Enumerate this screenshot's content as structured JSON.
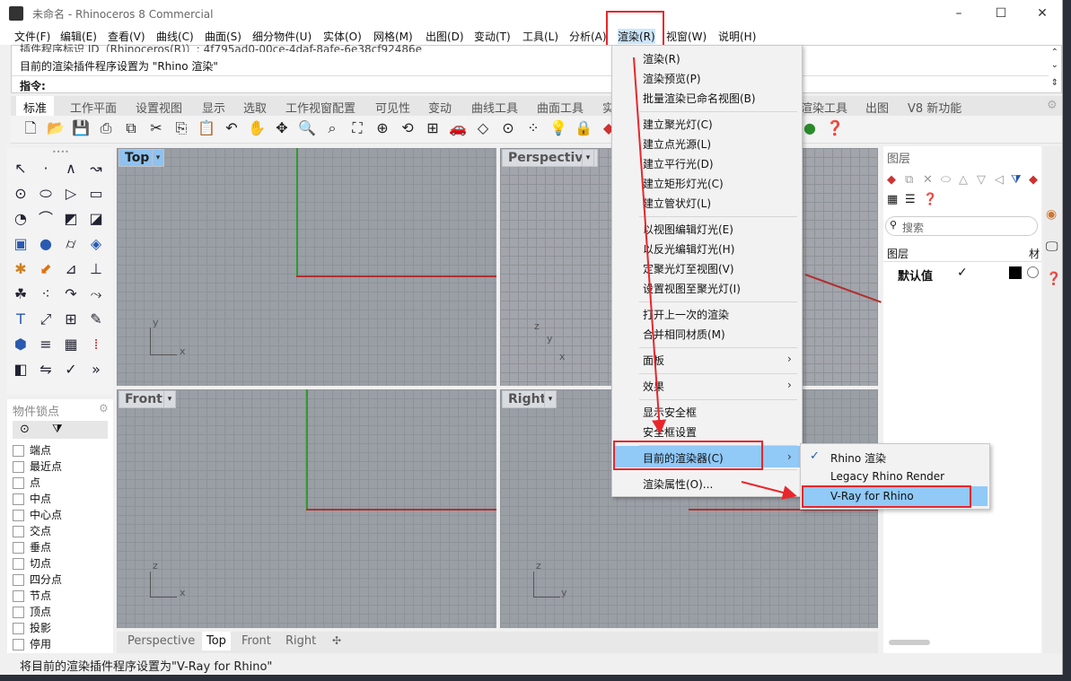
{
  "window": {
    "title": "未命名 - Rhinoceros 8 Commercial",
    "min": "–",
    "max": "☐",
    "close": "✕"
  },
  "menubar": [
    "文件(F)",
    "编辑(E)",
    "查看(V)",
    "曲线(C)",
    "曲面(S)",
    "细分物件(U)",
    "实体(O)",
    "网格(M)",
    "出图(D)",
    "变动(T)",
    "工具(L)",
    "分析(A)",
    "渲染(R)",
    "视窗(W)",
    "说明(H)"
  ],
  "command": {
    "history_line1": "插件程序标识 ID（Rhinoceros(R)）: 4f795ad0-00ce-4daf-8afe-6e38cf92486e",
    "history_line2": "目前的渲染插件程序设置为 \"Rhino 渲染\"",
    "prompt": "指令:"
  },
  "toolbar_tabs": [
    "标准",
    "工作平面",
    "设置视图",
    "显示",
    "选取",
    "工作视窗配置",
    "可见性",
    "变动",
    "曲线工具",
    "曲面工具",
    "实",
    "渲染工具",
    "出图",
    "V8 新功能"
  ],
  "viewports": {
    "top": "Top",
    "perspective": "Perspective",
    "front": "Front",
    "right": "Right"
  },
  "viewport_tabs": [
    "Perspective",
    "Top",
    "Front",
    "Right"
  ],
  "osnap": {
    "title": "物件锁点",
    "items": [
      "端点",
      "最近点",
      "点",
      "中点",
      "中心点",
      "交点",
      "垂点",
      "切点",
      "四分点",
      "节点",
      "顶点",
      "投影",
      "停用"
    ]
  },
  "layers": {
    "title": "图层",
    "search_placeholder": "搜索",
    "col_layer": "图层",
    "col_material": "材",
    "default_layer": "默认值",
    "check": "✓"
  },
  "render_menu": {
    "items": [
      "渲染(R)",
      "渲染预览(P)",
      "批量渲染已命名视图(B)",
      "建立聚光灯(C)",
      "建立点光源(L)",
      "建立平行光(D)",
      "建立矩形灯光(C)",
      "建立管状灯(L)",
      "以视图编辑灯光(E)",
      "以反光编辑灯光(H)",
      "定聚光灯至视图(V)",
      "设置视图至聚光灯(I)",
      "打开上一次的渲染",
      "合并相同材质(M)",
      "面板",
      "效果",
      "显示安全框",
      "安全框设置",
      "目前的渲染器(C)",
      "渲染属性(O)..."
    ]
  },
  "renderer_submenu": {
    "items": [
      "Rhino 渲染",
      "Legacy Rhino Render",
      "V-Ray for Rhino"
    ],
    "checked": "✓"
  },
  "status": "将目前的渲染插件程序设置为\"V-Ray for Rhino\"",
  "colors": {
    "highlight": "#91c9f7",
    "annotation_red": "#e8262b",
    "viewport_bg": "#9a9ea5"
  }
}
